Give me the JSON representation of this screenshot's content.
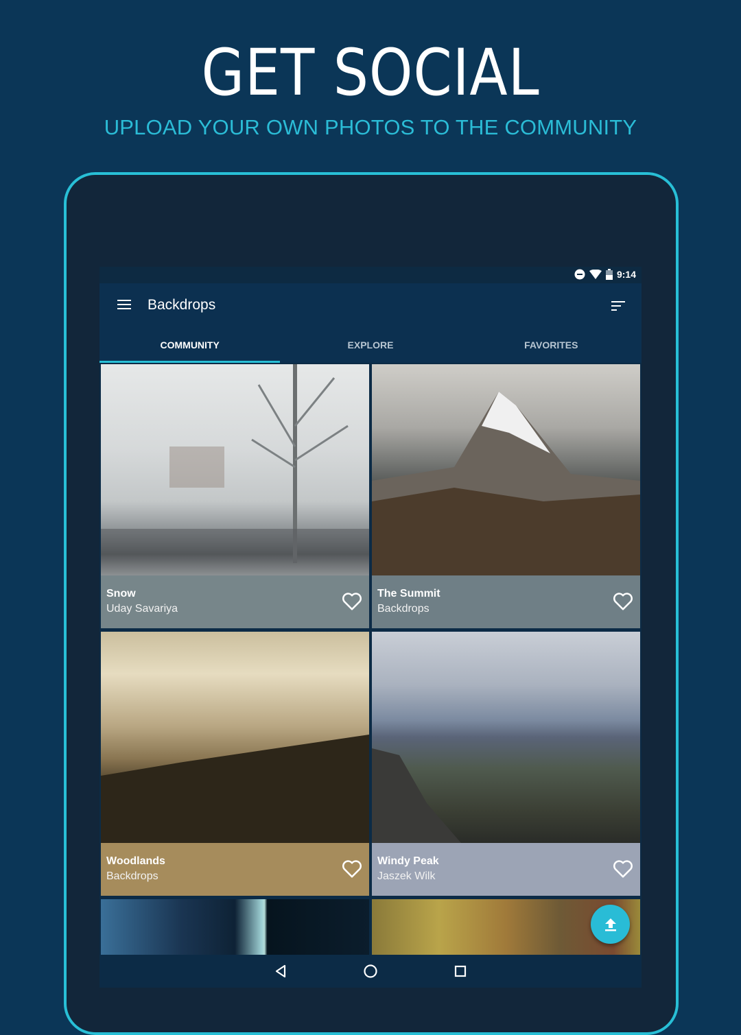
{
  "promo": {
    "headline": "GET SOCIAL",
    "subheadline": "UPLOAD YOUR OWN PHOTOS TO THE COMMUNITY"
  },
  "colors": {
    "background": "#0b3657",
    "accent": "#28bfd6",
    "toolbar": "#0c3050"
  },
  "status_bar": {
    "icons": [
      "do-not-disturb-icon",
      "wifi-icon",
      "battery-icon"
    ],
    "time": "9:14"
  },
  "app_bar": {
    "menu_icon": "hamburger-menu-icon",
    "title": "Backdrops",
    "sort_icon": "sort-icon"
  },
  "tabs": [
    {
      "label": "COMMUNITY",
      "active": true
    },
    {
      "label": "EXPLORE",
      "active": false
    },
    {
      "label": "FAVORITES",
      "active": false
    }
  ],
  "wallpapers": [
    {
      "title": "Snow",
      "author": "Uday Savariya",
      "caption_color": "#77868a",
      "favorite": false
    },
    {
      "title": "The Summit",
      "author": "Backdrops",
      "caption_color": "#6f7f86",
      "favorite": false
    },
    {
      "title": "Woodlands",
      "author": "Backdrops",
      "caption_color": "#a68c5c",
      "favorite": false
    },
    {
      "title": "Windy Peak",
      "author": "Jaszek Wilk",
      "caption_color": "#9ca4b5",
      "favorite": false
    }
  ],
  "fab": {
    "icon": "upload-icon"
  },
  "nav_bar": {
    "buttons": [
      "back-icon",
      "home-icon",
      "recents-icon"
    ]
  }
}
